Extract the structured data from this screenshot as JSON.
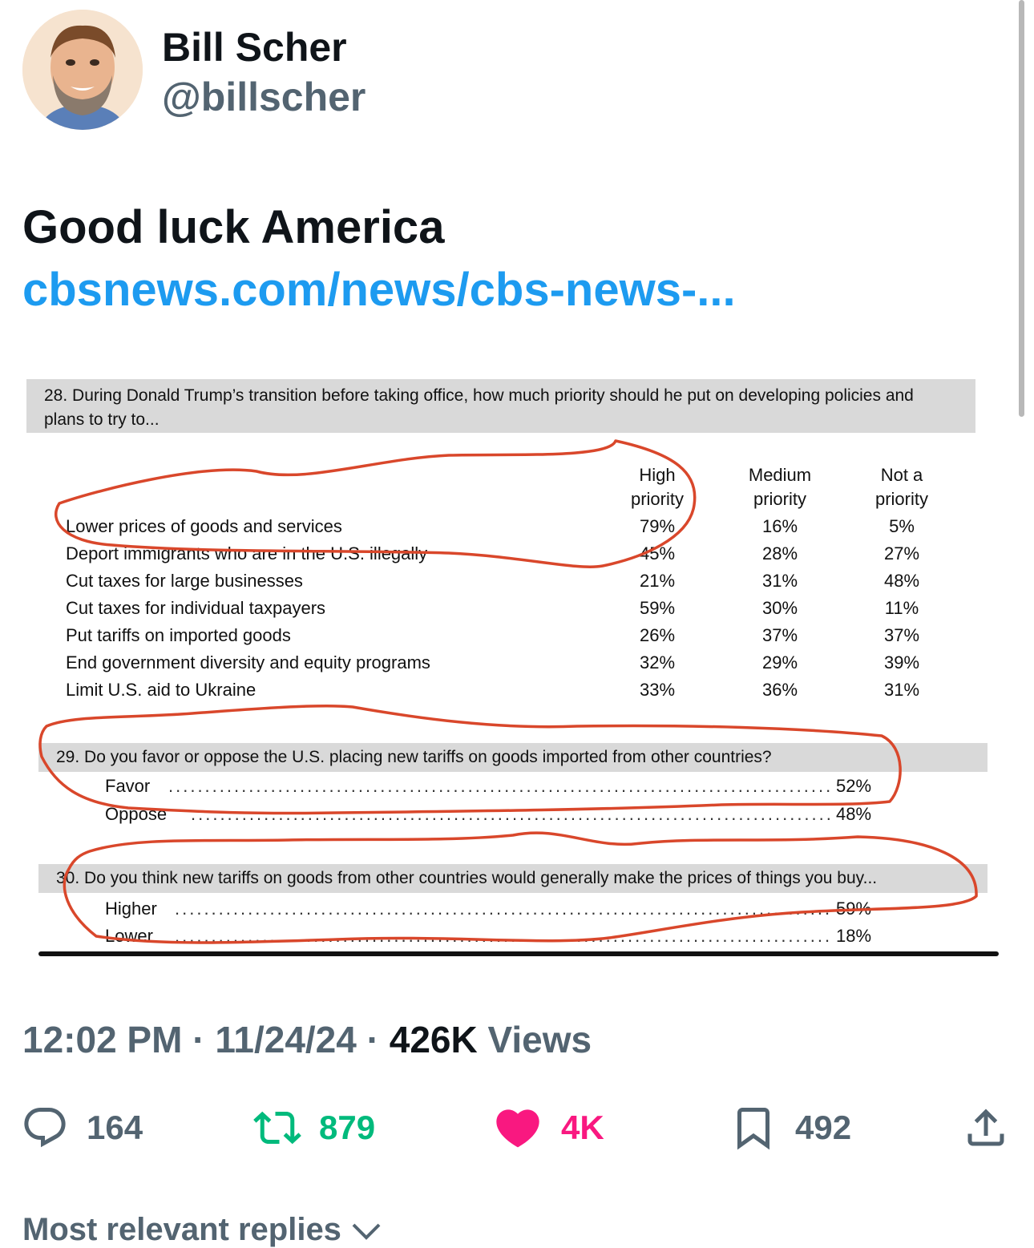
{
  "author": {
    "name": "Bill Scher",
    "handle": "@billscher"
  },
  "tweet": {
    "text": "Good luck America",
    "link": "cbsnews.com/news/cbs-news-..."
  },
  "poll_image": {
    "q28": {
      "question": "28. During Donald Trump’s transition before taking office, how much priority should he put on developing policies and plans to try to...",
      "columns": [
        {
          "line1": "High",
          "line2": "priority"
        },
        {
          "line1": "Medium",
          "line2": "priority"
        },
        {
          "line1": "Not a",
          "line2": "priority"
        }
      ],
      "rows": [
        {
          "label": "Lower prices of goods and services",
          "values": [
            "79%",
            "16%",
            "5%"
          ]
        },
        {
          "label": "Deport immigrants who are in the U.S. illegally",
          "values": [
            "45%",
            "28%",
            "27%"
          ]
        },
        {
          "label": "Cut taxes for large businesses",
          "values": [
            "21%",
            "31%",
            "48%"
          ]
        },
        {
          "label": "Cut taxes for individual taxpayers",
          "values": [
            "59%",
            "30%",
            "11%"
          ]
        },
        {
          "label": "Put tariffs on imported goods",
          "values": [
            "26%",
            "37%",
            "37%"
          ]
        },
        {
          "label": "End government diversity and equity programs",
          "values": [
            "32%",
            "29%",
            "39%"
          ]
        },
        {
          "label": "Limit U.S. aid to Ukraine",
          "values": [
            "33%",
            "36%",
            "31%"
          ]
        }
      ]
    },
    "q29": {
      "question": "29. Do you favor or oppose the U.S. placing new tariffs on goods imported from other countries?",
      "options": [
        {
          "label": "Favor",
          "value": "52%"
        },
        {
          "label": "Oppose",
          "value": "48%"
        }
      ]
    },
    "q30": {
      "question": "30. Do you think new tariffs on goods from other countries would generally make the prices of things you buy...",
      "options": [
        {
          "label": "Higher",
          "value": "59%"
        },
        {
          "label": "Lower",
          "value": "18%"
        }
      ]
    }
  },
  "meta": {
    "time": "12:02 PM",
    "date": "11/24/24",
    "views_count": "426K",
    "views_label": "Views"
  },
  "actions": {
    "replies": "164",
    "reposts": "879",
    "likes": "4K",
    "bookmarks": "492"
  },
  "replies_sort": "Most relevant replies",
  "colors": {
    "link": "#1d9bf0",
    "repost": "#00ba7c",
    "like": "#f91880",
    "secondary": "#536471",
    "annotation": "#d9472b"
  }
}
